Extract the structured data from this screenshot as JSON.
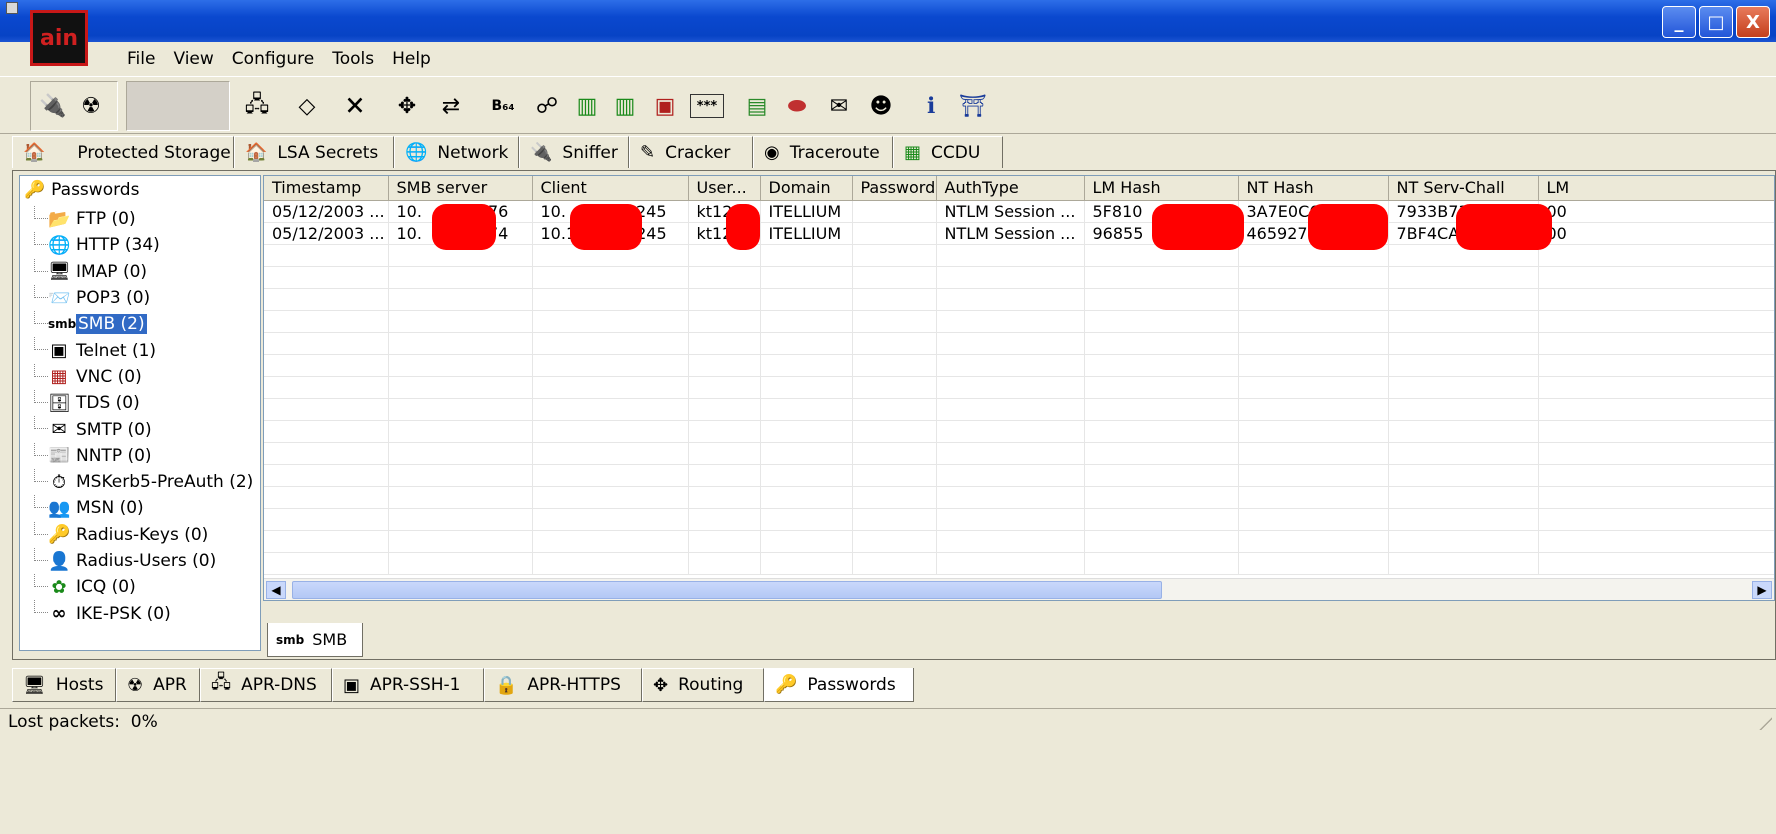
{
  "app": {
    "logo_text": "ain",
    "min_label": "_",
    "max_label": "□",
    "close_label": "X"
  },
  "menubar": [
    "File",
    "View",
    "Configure",
    "Tools",
    "Help"
  ],
  "toolbar_icons": [
    {
      "name": "sniffer-start-icon",
      "glyph": "🔌"
    },
    {
      "name": "apr-poison-icon",
      "glyph": "☢"
    },
    {
      "name": "add-hosts-icon",
      "glyph": "🖧"
    },
    {
      "name": "decoder-icon",
      "glyph": "◇"
    },
    {
      "name": "delete-icon",
      "glyph": "🗙"
    },
    {
      "name": "routing-icon",
      "glyph": "✥"
    },
    {
      "name": "arp-icon",
      "glyph": "⇄"
    },
    {
      "name": "base64-icon",
      "glyph": "B₆₄"
    },
    {
      "name": "hash-calculator-icon",
      "glyph": "☍"
    },
    {
      "name": "dialer-icon",
      "glyph": "▥"
    },
    {
      "name": "dialer2-icon",
      "glyph": "▥"
    },
    {
      "name": "vnc-icon",
      "glyph": "▣"
    },
    {
      "name": "password-icon",
      "glyph": "***"
    },
    {
      "name": "card-icon",
      "glyph": "▤"
    },
    {
      "name": "certificate-icon",
      "glyph": "⬬"
    },
    {
      "name": "manager-icon",
      "glyph": "✉"
    },
    {
      "name": "rdp-icon",
      "glyph": "☻"
    },
    {
      "name": "info-icon",
      "glyph": "ℹ"
    },
    {
      "name": "exit-icon",
      "glyph": "⛩"
    }
  ],
  "top_tabs": [
    {
      "label": "Protected Storage",
      "icon": "🏠"
    },
    {
      "label": "LSA Secrets",
      "icon": "🏠"
    },
    {
      "label": "Network",
      "icon": "🌐"
    },
    {
      "label": "Sniffer",
      "icon": "🔌"
    },
    {
      "label": "Cracker",
      "icon": "✎"
    },
    {
      "label": "Traceroute",
      "icon": "◉"
    },
    {
      "label": "CCDU",
      "icon": "▦"
    }
  ],
  "tree": {
    "root": "Passwords",
    "items": [
      {
        "label": "FTP (0)",
        "icon": "📂"
      },
      {
        "label": "HTTP (34)",
        "icon": "🌐"
      },
      {
        "label": "IMAP (0)",
        "icon": "🖥"
      },
      {
        "label": "POP3 (0)",
        "icon": "📨"
      },
      {
        "label": "SMB (2)",
        "icon": "smb",
        "selected": true
      },
      {
        "label": "Telnet (1)",
        "icon": "▣"
      },
      {
        "label": "VNC (0)",
        "icon": "▦"
      },
      {
        "label": "TDS (0)",
        "icon": "🗄"
      },
      {
        "label": "SMTP (0)",
        "icon": "✉"
      },
      {
        "label": "NNTP (0)",
        "icon": "📰"
      },
      {
        "label": "MSKerb5-PreAuth (2)",
        "icon": "⏱"
      },
      {
        "label": "MSN (0)",
        "icon": "👥"
      },
      {
        "label": "Radius-Keys (0)",
        "icon": "🔑"
      },
      {
        "label": "Radius-Users (0)",
        "icon": "👤"
      },
      {
        "label": "ICQ (0)",
        "icon": "✿"
      },
      {
        "label": "IKE-PSK (0)",
        "icon": "∞"
      }
    ]
  },
  "table": {
    "columns": [
      "Timestamp",
      "SMB server",
      "Client",
      "User...",
      "Domain",
      "Password",
      "AuthType",
      "LM Hash",
      "NT Hash",
      "NT Serv-Chall",
      "LM"
    ],
    "rows": [
      [
        "05/12/2003 ...",
        "10.",
        "76",
        "10.",
        "245",
        "kt12",
        "ITELLIUM",
        "",
        "NTLM Session ...",
        "5F810",
        "3A7E0C6",
        "7933B739",
        "00"
      ],
      [
        "05/12/2003 ...",
        "10.",
        "74",
        "10.1",
        "245",
        "kt12",
        "ITELLIUM",
        "",
        "NTLM Session ...",
        "96855",
        "465927E",
        "7BF4CAC",
        "00"
      ]
    ]
  },
  "subtab": {
    "icon": "smb",
    "label": "SMB"
  },
  "bottom_tabs": [
    {
      "label": "Hosts",
      "icon": "🖥"
    },
    {
      "label": "APR",
      "icon": "☢"
    },
    {
      "label": "APR-DNS",
      "icon": "🖧"
    },
    {
      "label": "APR-SSH-1",
      "icon": "▣"
    },
    {
      "label": "APR-HTTPS",
      "icon": "🔒"
    },
    {
      "label": "Routing",
      "icon": "✥"
    },
    {
      "label": "Passwords",
      "icon": "🔑",
      "active": true
    }
  ],
  "status": {
    "text": "Lost packets:  0%"
  }
}
